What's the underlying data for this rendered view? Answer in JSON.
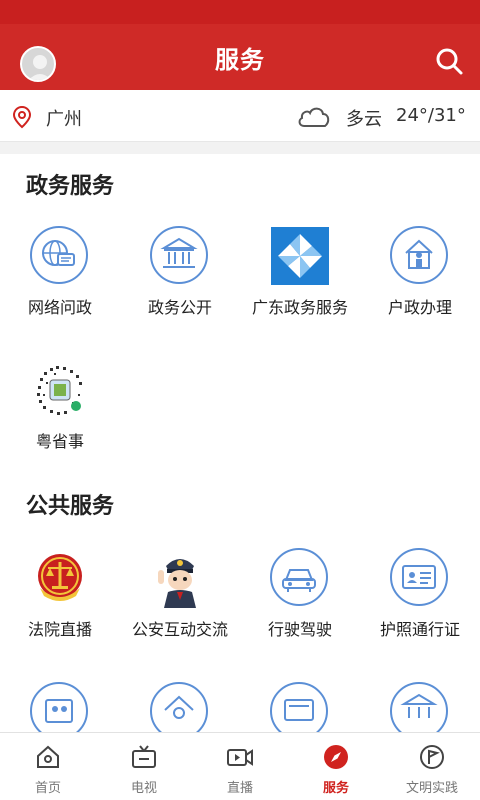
{
  "header": {
    "title": "服务"
  },
  "location": {
    "city": "广州",
    "weather": "多云",
    "temperature": "24°/31°"
  },
  "sections": {
    "gov": {
      "title": "政务服务",
      "items": [
        "网络问政",
        "政务公开",
        "广东政务服务",
        "户政办理",
        "粤省事"
      ]
    },
    "public": {
      "title": "公共服务",
      "items": [
        "法院直播",
        "公安互动交流",
        "行驶驾驶",
        "护照通行证"
      ]
    }
  },
  "tabs": [
    "首页",
    "电视",
    "直播",
    "服务",
    "文明实践"
  ],
  "colors": {
    "brand_red": "#cf2a27",
    "icon_blue": "#5b8fd6"
  },
  "icons": {
    "gov": [
      "globe-chat-icon",
      "government-building-icon",
      "pinwheel-logo-icon",
      "house-person-icon",
      "qr-code-icon"
    ],
    "public": [
      "court-emblem-icon",
      "police-cartoon-icon",
      "car-icon",
      "id-card-icon"
    ],
    "partial": [
      "contacts-card-icon",
      "house-search-icon",
      "document-currency-icon",
      "bank-building-icon"
    ]
  }
}
